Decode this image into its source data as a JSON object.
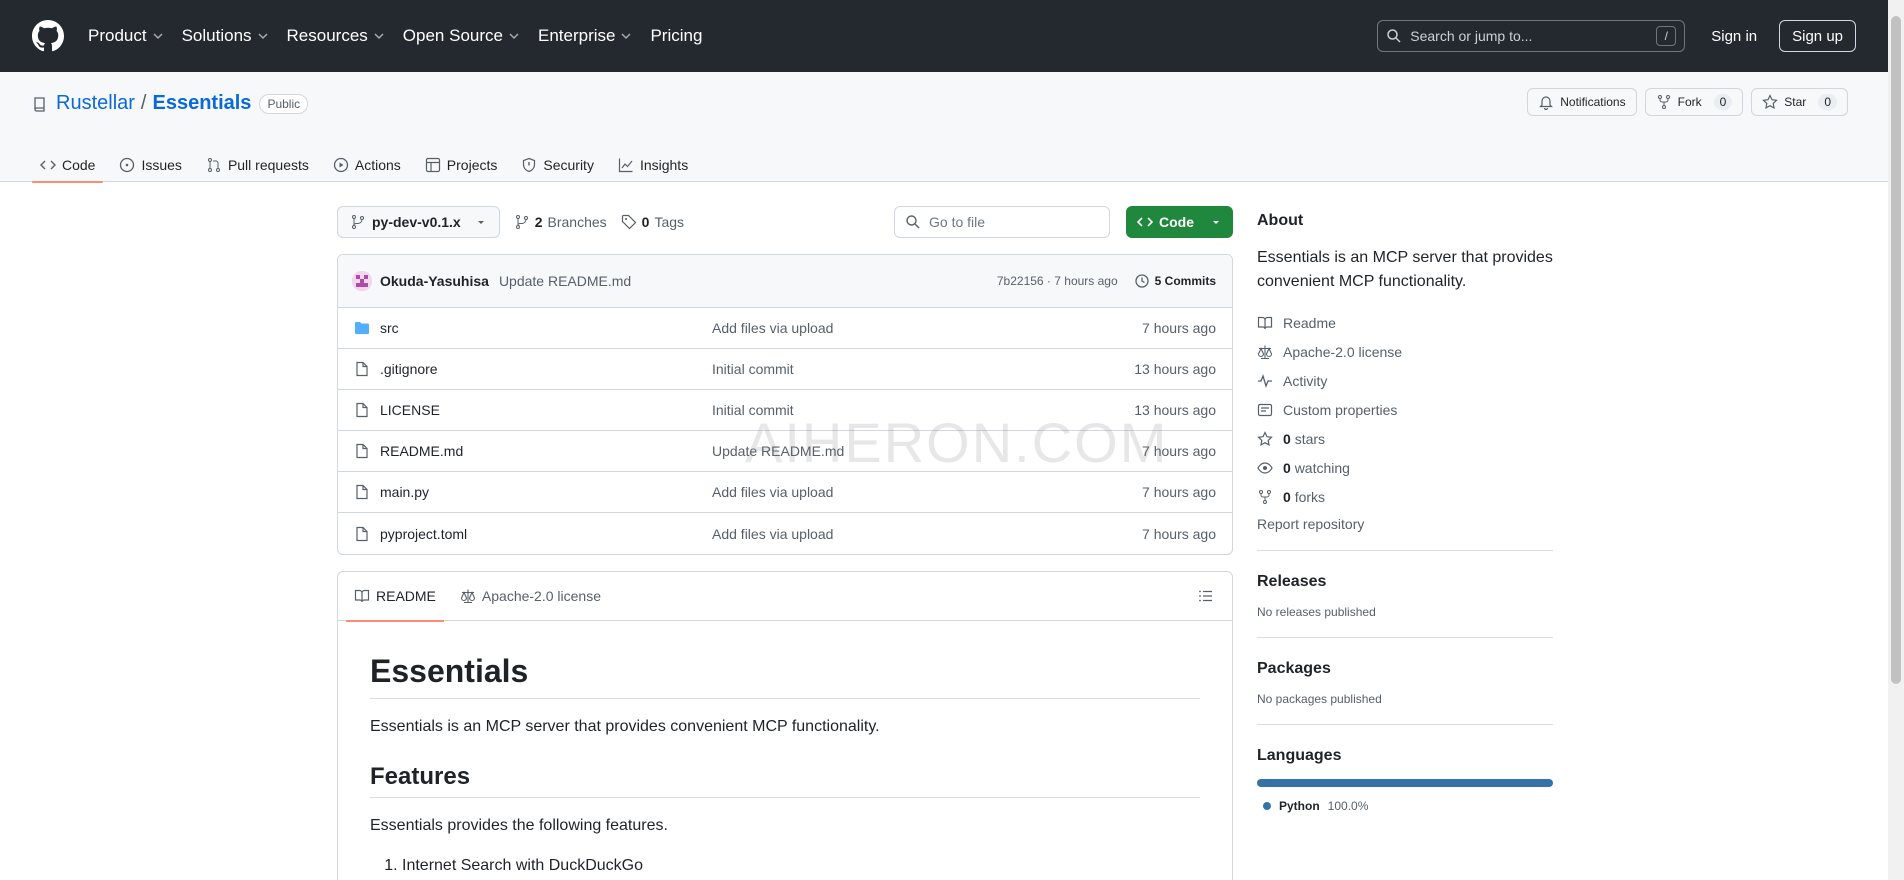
{
  "header": {
    "nav": [
      "Product",
      "Solutions",
      "Resources",
      "Open Source",
      "Enterprise",
      "Pricing"
    ],
    "search_placeholder": "Search or jump to...",
    "search_shortcut": "/",
    "signin": "Sign in",
    "signup": "Sign up"
  },
  "repo": {
    "owner": "Rustellar",
    "separator": "/",
    "name": "Essentials",
    "visibility": "Public",
    "notifications": "Notifications",
    "fork": "Fork",
    "fork_count": "0",
    "star": "Star",
    "star_count": "0"
  },
  "tabs": [
    "Code",
    "Issues",
    "Pull requests",
    "Actions",
    "Projects",
    "Security",
    "Insights"
  ],
  "toolbar": {
    "branch": "py-dev-v0.1.x",
    "branches_count": "2",
    "branches_label": "Branches",
    "tags_count": "0",
    "tags_label": "Tags",
    "goto_placeholder": "Go to file",
    "code_button": "Code"
  },
  "commit": {
    "author": "Okuda-Yasuhisa",
    "message": "Update README.md",
    "hash_time": "7b22156 · 7 hours ago",
    "commits": "5 Commits"
  },
  "files": [
    {
      "name": "src",
      "type": "folder",
      "message": "Add files via upload",
      "time": "7 hours ago"
    },
    {
      "name": ".gitignore",
      "type": "file",
      "message": "Initial commit",
      "time": "13 hours ago"
    },
    {
      "name": "LICENSE",
      "type": "file",
      "message": "Initial commit",
      "time": "13 hours ago"
    },
    {
      "name": "README.md",
      "type": "file",
      "message": "Update README.md",
      "time": "7 hours ago"
    },
    {
      "name": "main.py",
      "type": "file",
      "message": "Add files via upload",
      "time": "7 hours ago"
    },
    {
      "name": "pyproject.toml",
      "type": "file",
      "message": "Add files via upload",
      "time": "7 hours ago"
    }
  ],
  "readme": {
    "tab_readme": "README",
    "tab_license": "Apache-2.0 license",
    "title": "Essentials",
    "intro": "Essentials is an MCP server that provides convenient MCP functionality.",
    "features_heading": "Features",
    "features_intro": "Essentials provides the following features.",
    "feature_1": "Internet Search with DuckDuckGo"
  },
  "sidebar": {
    "about_heading": "About",
    "about_text": "Essentials is an MCP server that provides convenient MCP functionality.",
    "readme": "Readme",
    "license": "Apache-2.0 license",
    "activity": "Activity",
    "custom_properties": "Custom properties",
    "stars_count": "0",
    "stars_label": "stars",
    "watching_count": "0",
    "watching_label": "watching",
    "forks_count": "0",
    "forks_label": "forks",
    "report": "Report repository",
    "releases_heading": "Releases",
    "releases_text": "No releases published",
    "packages_heading": "Packages",
    "packages_text": "No packages published",
    "languages_heading": "Languages",
    "language_name": "Python",
    "language_pct": "100.0%"
  },
  "watermark": "AIHERON.COM",
  "colors": {
    "header_bg": "#24292f",
    "link": "#0969da",
    "green": "#1f883d",
    "python": "#3572a5",
    "active_tab": "#fd8c73"
  }
}
